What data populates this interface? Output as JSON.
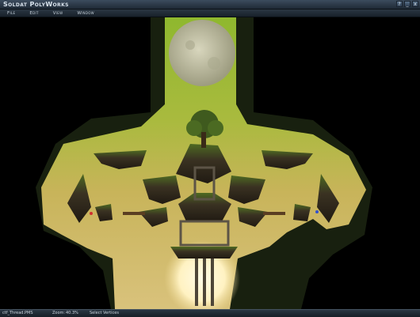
{
  "window": {
    "title": "Soldat PolyWorks",
    "controls": {
      "help": "?",
      "minimize": "_",
      "close": "x"
    }
  },
  "menu": {
    "items": [
      "File",
      "Edit",
      "View",
      "Window"
    ]
  },
  "status": {
    "file": "ctf_Thread.PMS",
    "zoom_label": "Zoom:",
    "zoom": "40.3%",
    "tool": "Select Vertices"
  },
  "colors": {
    "titlebar": "#2c3a48",
    "sky_top": "#9fc03a",
    "sky_bottom": "#e2c98a",
    "dark_bg": "#000000"
  }
}
